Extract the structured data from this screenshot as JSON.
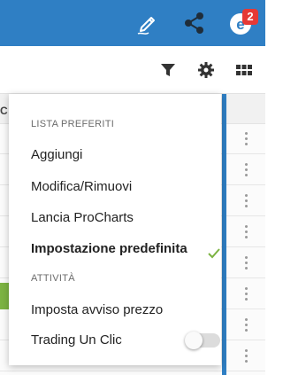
{
  "header": {
    "icons": [
      "pencil-icon",
      "share-icon",
      "notification-icon"
    ],
    "badge_count": "2",
    "color": "#2f7fc4"
  },
  "toolbar": {
    "icons": [
      "filter-icon",
      "gear-icon",
      "grid-icon"
    ]
  },
  "background": {
    "header_text": "C"
  },
  "menu": {
    "watchlist_section": "LISTA PREFERITI",
    "items": [
      {
        "label": "Aggiungi"
      },
      {
        "label": "Modifica/Rimuovi"
      },
      {
        "label": "Lancia ProCharts"
      },
      {
        "label": "Impostazione predefinita",
        "checked": true
      }
    ],
    "activity_section": "ATTIVITÀ",
    "activity_items": [
      {
        "label": "Imposta avviso prezzo"
      },
      {
        "label": "Trading Un Clic",
        "toggle": false
      }
    ],
    "check_color": "#7cb342"
  }
}
